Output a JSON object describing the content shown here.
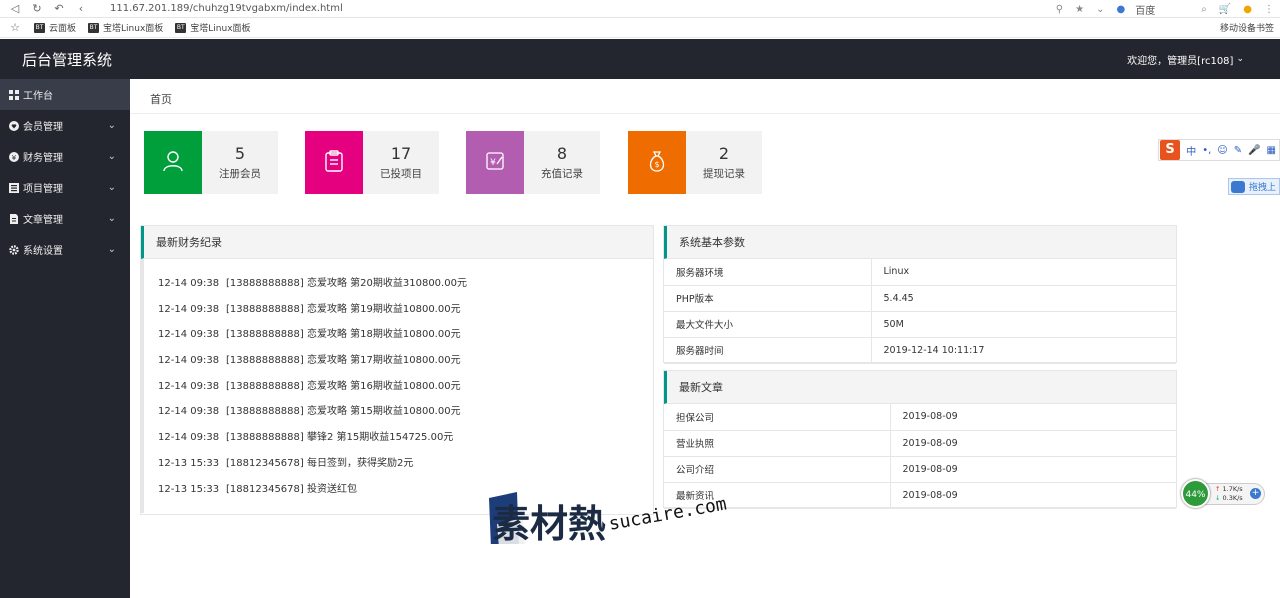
{
  "browser": {
    "url": "111.67.201.189/chuhzg19tvgabxm/index.html",
    "search_engine": "百度",
    "bookmarks": [
      "云面板",
      "宝塔Linux面板",
      "宝塔Linux面板"
    ],
    "bookmark_badge": "BT",
    "mobile_bookmarks": "移动设备书签"
  },
  "header": {
    "title": "后台管理系统",
    "user_menu": "欢迎您，管理员[rc108]"
  },
  "sidebar": {
    "items": [
      {
        "label": "工作台",
        "icon": "dashboard-icon"
      },
      {
        "label": "会员管理",
        "icon": "heart-icon"
      },
      {
        "label": "财务管理",
        "icon": "yen-icon"
      },
      {
        "label": "项目管理",
        "icon": "list-icon"
      },
      {
        "label": "文章管理",
        "icon": "document-icon"
      },
      {
        "label": "系统设置",
        "icon": "gear-icon"
      }
    ]
  },
  "breadcrumb": "首页",
  "stats": [
    {
      "value": "5",
      "label": "注册会员",
      "color": "#009688",
      "icon": "user-icon"
    },
    {
      "value": "17",
      "label": "已投项目",
      "color": "#e5007f",
      "icon": "clipboard-icon"
    },
    {
      "value": "8",
      "label": "充值记录",
      "color": "#b25db0",
      "icon": "recharge-icon"
    },
    {
      "value": "2",
      "label": "提现记录",
      "color": "#ee6c00",
      "icon": "money-bag-icon"
    }
  ],
  "finance": {
    "title": "最新财务纪录",
    "rows": [
      {
        "time": "12-14 09:38",
        "text": "[13888888888] 恋爱攻略 第20期收益310800.00元"
      },
      {
        "time": "12-14 09:38",
        "text": "[13888888888] 恋爱攻略 第19期收益10800.00元"
      },
      {
        "time": "12-14 09:38",
        "text": "[13888888888] 恋爱攻略 第18期收益10800.00元"
      },
      {
        "time": "12-14 09:38",
        "text": "[13888888888] 恋爱攻略 第17期收益10800.00元"
      },
      {
        "time": "12-14 09:38",
        "text": "[13888888888] 恋爱攻略 第16期收益10800.00元"
      },
      {
        "time": "12-14 09:38",
        "text": "[13888888888] 恋爱攻略 第15期收益10800.00元"
      },
      {
        "time": "12-14 09:38",
        "text": "[13888888888] 攀锋2 第15期收益154725.00元"
      },
      {
        "time": "12-13 15:33",
        "text": "[18812345678] 每日签到，获得奖励2元"
      },
      {
        "time": "12-13 15:33",
        "text": "[18812345678] 投资送红包"
      }
    ]
  },
  "system": {
    "title": "系统基本参数",
    "rows": [
      {
        "k": "服务器环境",
        "v": "Linux"
      },
      {
        "k": "PHP版本",
        "v": "5.4.45"
      },
      {
        "k": "最大文件大小",
        "v": "50M"
      },
      {
        "k": "服务器时间",
        "v": "2019-12-14 10:11:17"
      }
    ]
  },
  "articles": {
    "title": "最新文章",
    "rows": [
      {
        "k": "担保公司",
        "v": "2019-08-09"
      },
      {
        "k": "营业执照",
        "v": "2019-08-09"
      },
      {
        "k": "公司介绍",
        "v": "2019-08-09"
      },
      {
        "k": "最新资讯",
        "v": "2019-08-09"
      }
    ]
  },
  "overlays": {
    "ime_key": "中",
    "cloud_label": "拖拽上",
    "net_percent": "44%",
    "net_up": "1.7K/s",
    "net_down": "0.3K/s",
    "net_plus": "+"
  },
  "watermark": {
    "cn": "素材熱",
    "url": "sucaire.com"
  }
}
